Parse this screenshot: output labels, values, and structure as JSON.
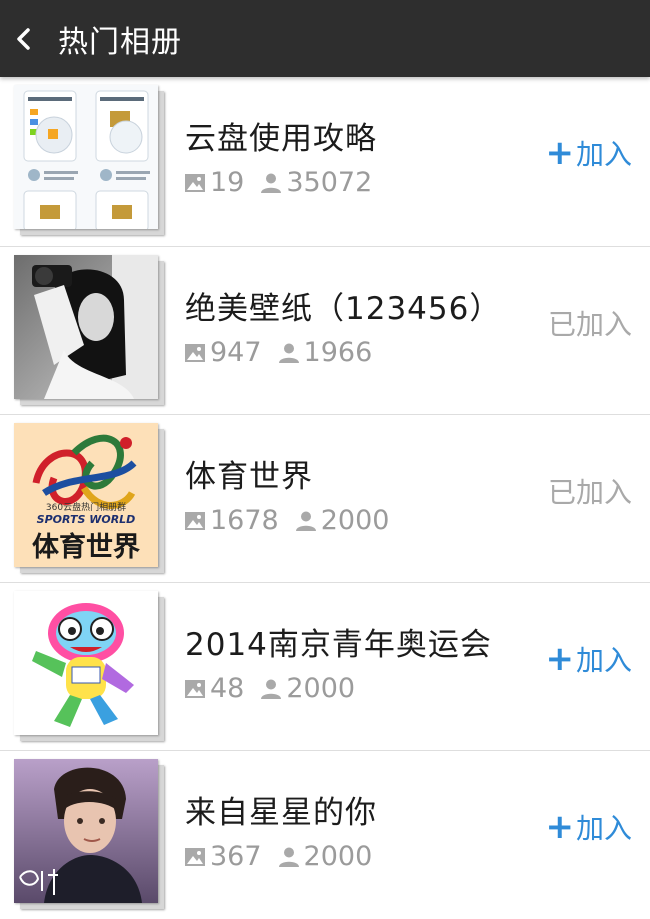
{
  "header": {
    "title": "热门相册",
    "back_icon": "chevron-left-icon"
  },
  "albums": [
    {
      "name": "云盘使用攻略",
      "photos": "19",
      "members": "35072",
      "action": "加入",
      "joined": false
    },
    {
      "name": "绝美壁纸（123456）",
      "photos": "947",
      "members": "1966",
      "action": "已加入",
      "joined": true
    },
    {
      "name": "体育世界",
      "photos": "1678",
      "members": "2000",
      "action": "已加入",
      "joined": true
    },
    {
      "name": "2014南京青年奥运会",
      "photos": "48",
      "members": "2000",
      "action": "加入",
      "joined": false
    },
    {
      "name": "来自星星的你",
      "photos": "367",
      "members": "2000",
      "action": "加入",
      "joined": false
    }
  ],
  "thumb_texts": {
    "sports_line1": "360云盘热门相册群",
    "sports_line2": "SPORTS WORLD",
    "sports_line3": "体育世界"
  },
  "colors": {
    "accent": "#2f8bd8",
    "muted": "#a9a9a9",
    "topbar": "#2e2e2e"
  }
}
